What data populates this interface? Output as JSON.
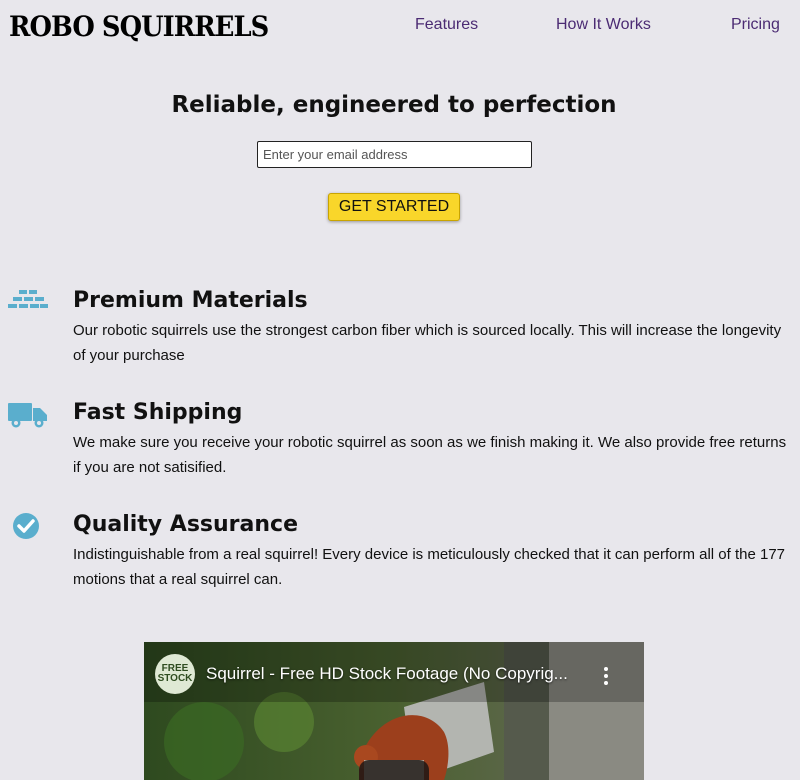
{
  "header": {
    "logo": "ROBO SQUIRRELS",
    "nav": [
      "Features",
      "How It Works",
      "Pricing"
    ]
  },
  "hero": {
    "title": "Reliable, engineered to perfection",
    "email_placeholder": "Enter your email address",
    "cta_label": "GET STARTED"
  },
  "features": [
    {
      "icon": "bricks-icon",
      "title": "Premium Materials",
      "text": "Our robotic squirrels use the strongest carbon fiber which is sourced locally. This will increase the longevity of your purchase"
    },
    {
      "icon": "truck-icon",
      "title": "Fast Shipping",
      "text": "We make sure you receive your robotic squirrel as soon as we finish making it. We also provide free returns if you are not satisified."
    },
    {
      "icon": "check-circle-icon",
      "title": "Quality Assurance",
      "text": "Indistinguishable from a real squirrel! Every device is meticulously checked that it can perform all of the 177 motions that a real squirrel can."
    }
  ],
  "video": {
    "channel_logo_top": "FREE",
    "channel_logo_bottom": "STOCK",
    "title": "Squirrel - Free HD Stock Footage (No Copyrig..."
  },
  "colors": {
    "background": "#e8e7ec",
    "nav_link": "#4b2b73",
    "cta": "#f9d62a",
    "icon": "#5aaecd"
  }
}
